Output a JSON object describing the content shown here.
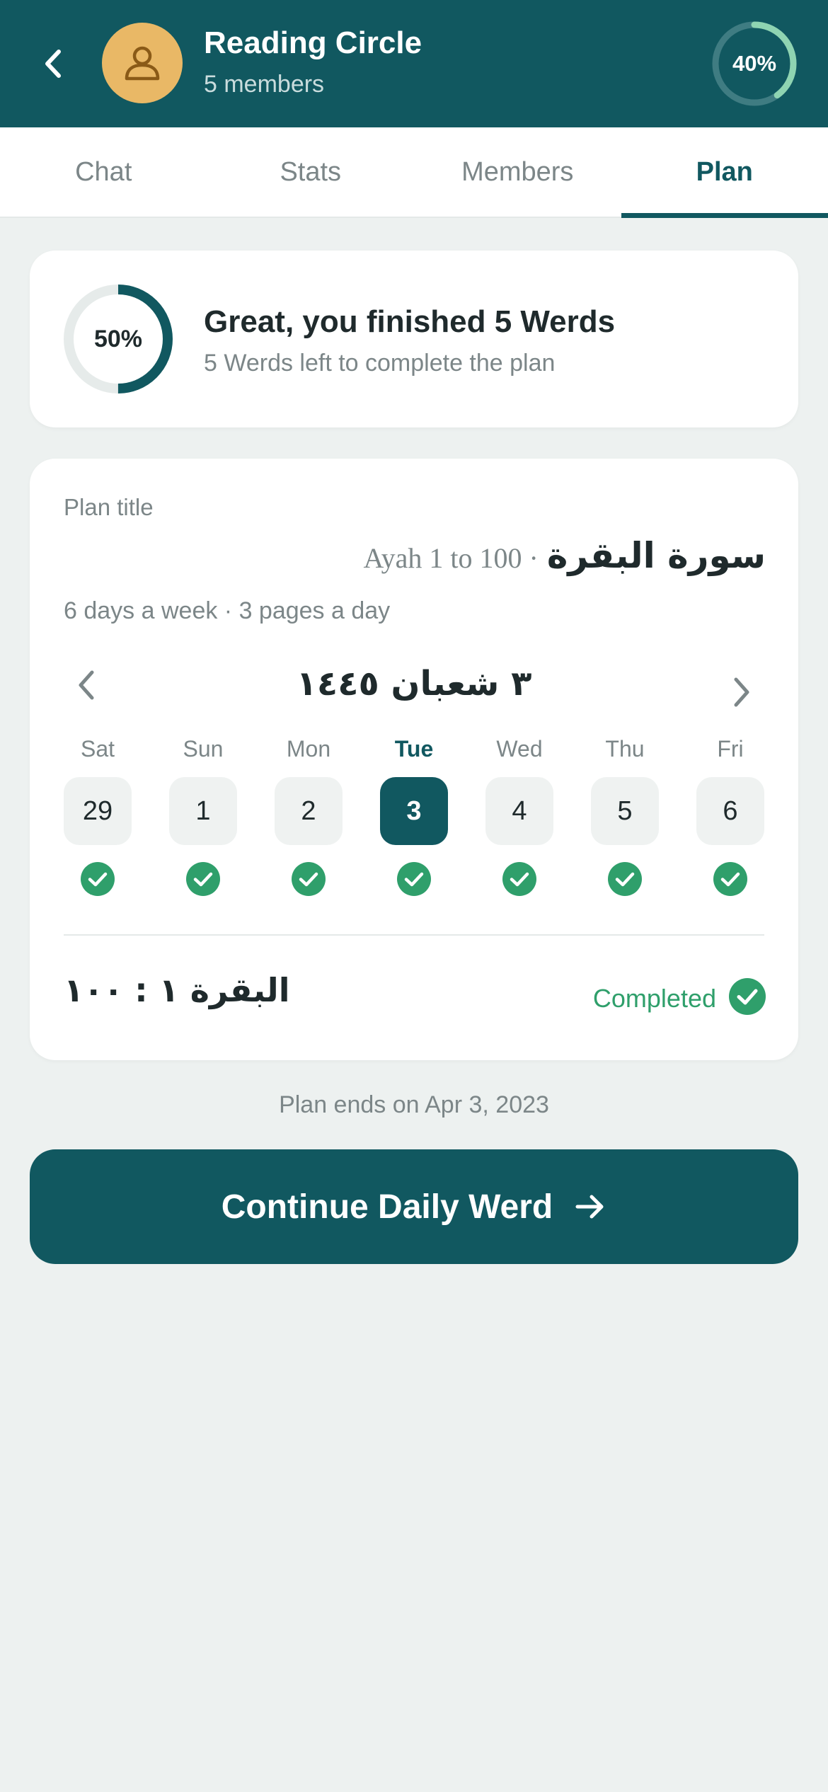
{
  "header": {
    "title": "Reading Circle",
    "subtitle": "5 members",
    "progress_label": "40%",
    "progress_value": 0.4
  },
  "tabs": [
    {
      "label": "Chat",
      "active": false
    },
    {
      "label": "Stats",
      "active": false
    },
    {
      "label": "Members",
      "active": false
    },
    {
      "label": "Plan",
      "active": true
    }
  ],
  "summary": {
    "progress_label": "50%",
    "progress_value": 0.5,
    "title": "Great, you finished 5 Werds",
    "subtitle": "5 Werds left to complete the plan"
  },
  "plan": {
    "label": "Plan title",
    "surah": "سورة البقرة",
    "ayah_range": "Ayah 1 to 100 ·",
    "schedule": "6 days a week · 3 pages a day",
    "calendar_month": "٣ شعبان ١٤٤٥",
    "days": [
      {
        "name": "Sat",
        "num": "29",
        "today": false,
        "done": true
      },
      {
        "name": "Sun",
        "num": "1",
        "today": false,
        "done": true
      },
      {
        "name": "Mon",
        "num": "2",
        "today": false,
        "done": true
      },
      {
        "name": "Tue",
        "num": "3",
        "today": true,
        "done": true
      },
      {
        "name": "Wed",
        "num": "4",
        "today": false,
        "done": true
      },
      {
        "name": "Thu",
        "num": "5",
        "today": false,
        "done": true
      },
      {
        "name": "Fri",
        "num": "6",
        "today": false,
        "done": true
      }
    ],
    "range_text": "البقرة ١ : ١٠٠",
    "status": "Completed"
  },
  "plan_ends": "Plan ends on Apr 3, 2023",
  "cta": {
    "label": "Continue Daily Werd"
  },
  "colors": {
    "primary": "#115860",
    "avatar": "#e9b866",
    "success": "#2f9f6b",
    "ring_track": "#e6ebea"
  },
  "icons": {
    "back": "chevron-left-icon",
    "avatar": "user-icon",
    "check": "check-circle-icon",
    "cta": "arrow-right-icon"
  }
}
